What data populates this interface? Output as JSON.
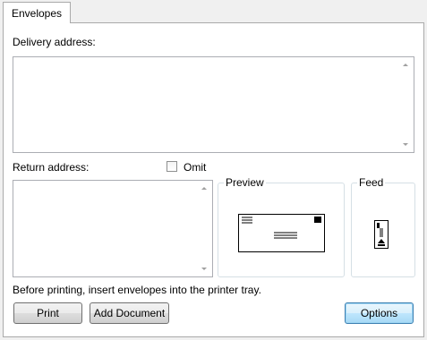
{
  "tab": {
    "label": "Envelopes"
  },
  "delivery": {
    "label": "Delivery address:",
    "value": ""
  },
  "return_addr": {
    "label": "Return address:",
    "value": "",
    "omit_label": "Omit",
    "omit_checked": false
  },
  "preview": {
    "title": "Preview"
  },
  "feed": {
    "title": "Feed"
  },
  "instruction": "Before printing, insert envelopes into the printer tray.",
  "buttons": {
    "print": "Print",
    "add_document": "Add Document",
    "options": "Options"
  }
}
